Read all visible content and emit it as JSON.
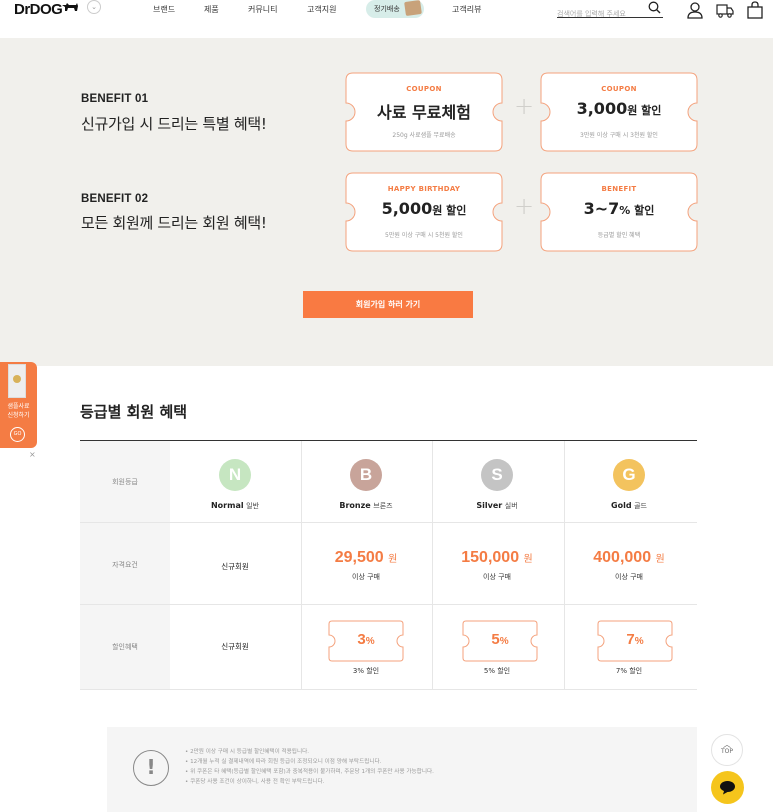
{
  "header": {
    "logo": "DrDOG",
    "nav": [
      "브랜드",
      "제품",
      "커뮤니티",
      "고객지원",
      "정기배송",
      "고객리뷰"
    ],
    "search_placeholder": "검색어를 입력해 주세요"
  },
  "benefits": [
    {
      "title": "BENEFIT 01",
      "subtitle": "신규가입 시 드리는 특별 혜택!",
      "tickets": [
        {
          "tag": "COUPON",
          "main": "사료 무료체험",
          "unit": "",
          "desc": "250g 사료샘플 무료배송"
        },
        {
          "tag": "COUPON",
          "main": "3,000",
          "unit": "원 할인",
          "desc": "3만원 이상 구매 시 3천원 할인"
        }
      ]
    },
    {
      "title": "BENEFIT 02",
      "subtitle": "모든 회원께 드리는 회원 혜택!",
      "tickets": [
        {
          "tag": "HAPPY BIRTHDAY",
          "main": "5,000",
          "unit": "원 할인",
          "desc": "5만원 이상 구매 시 5천원 할인"
        },
        {
          "tag": "BENEFIT",
          "main": "3~7",
          "unit": "% 할인",
          "desc": "등급별 할인 혜택"
        }
      ]
    }
  ],
  "join_button": "회원가입 하러 가기",
  "sample_badge": {
    "line1": "샘플사료",
    "line2": "신청하기",
    "go": "GO",
    "close": "×"
  },
  "grade_section": {
    "title": "등급별 회원 혜택",
    "row_labels": [
      "회원등급",
      "자격요건",
      "할인혜택"
    ],
    "grades": [
      {
        "letter": "N",
        "en": "Normal",
        "ko": "일반",
        "color": "#c6e6c1",
        "requirement": "신규회원",
        "benefit": "신규회원"
      },
      {
        "letter": "B",
        "en": "Bronze",
        "ko": "브론즈",
        "color": "#c8a49a",
        "price": "29,500",
        "price_unit": "원",
        "price_sub": "이상 구매",
        "pct": "3",
        "pct_sub": "3% 할인"
      },
      {
        "letter": "S",
        "en": "Silver",
        "ko": "실버",
        "color": "#c4c4c4",
        "price": "150,000",
        "price_unit": "원",
        "price_sub": "이상 구매",
        "pct": "5",
        "pct_sub": "5% 할인"
      },
      {
        "letter": "G",
        "en": "Gold",
        "ko": "골드",
        "color": "#f3c35e",
        "price": "400,000",
        "price_unit": "원",
        "price_sub": "이상 구매",
        "pct": "7",
        "pct_sub": "7% 할인"
      }
    ]
  },
  "notice": [
    "• 2만원 이상 구매 시 등급별 할인혜택이 적용됩니다.",
    "• 12개월 누적 실 결제내역에 따라 회원 등급이 조정되오니 이점 양해 부탁드립니다.",
    "• 위 쿠폰은 타 혜택(등급별 할인혜택 포함)과 중복적용이 불가하며, 주문당 1개의 쿠폰만 사용 가능합니다.",
    "• 쿠폰당 사용 조건이 상이하니, 사용 전 확인 부탁드립니다."
  ],
  "top_button": "TOP",
  "colors": {
    "accent": "#f47c44",
    "band": "#f1f0ec"
  }
}
